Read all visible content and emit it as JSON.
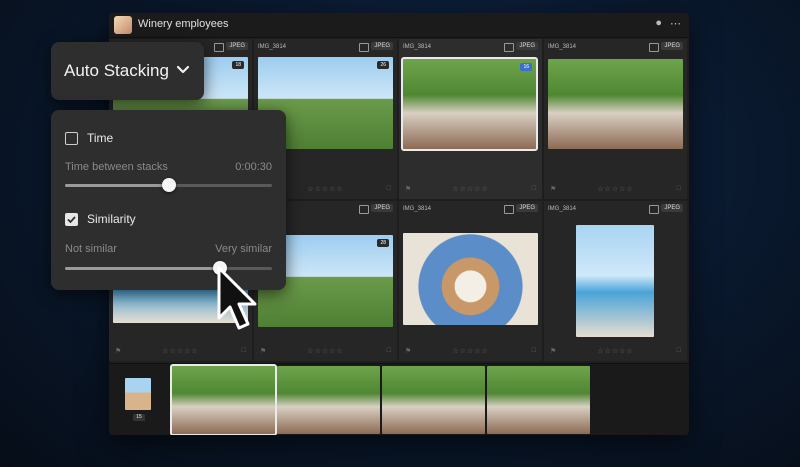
{
  "album": {
    "title": "Winery employees"
  },
  "stacking": {
    "mode_label": "Auto Stacking",
    "time": {
      "label": "Time",
      "checked": false,
      "sub_label": "Time between stacks",
      "value": "0:00:30",
      "level": 0.5
    },
    "similarity": {
      "label": "Similarity",
      "checked": true,
      "left_label": "Not similar",
      "right_label": "Very similar",
      "level": 0.75
    }
  },
  "grid": {
    "cells": [
      {
        "name": "",
        "type": "JPEG",
        "count": "18"
      },
      {
        "name": "IMG_3814",
        "type": "JPEG",
        "count": "26"
      },
      {
        "name": "IMG_3814",
        "type": "JPEG",
        "count": "16"
      },
      {
        "name": "IMG_3814",
        "type": "JPEG",
        "count": ""
      },
      {
        "name": "",
        "type": "",
        "count": ""
      },
      {
        "name": "",
        "type": "JPEG",
        "count": "28"
      },
      {
        "name": "IMG_3814",
        "type": "JPEG",
        "count": ""
      },
      {
        "name": "IMG_3814",
        "type": "JPEG",
        "count": ""
      }
    ]
  },
  "filmstrip": {
    "stack_badge": "15"
  },
  "colors": {
    "accent": "#ffffff",
    "panel": "#2e2e2e",
    "background": "#1e1e1e"
  }
}
